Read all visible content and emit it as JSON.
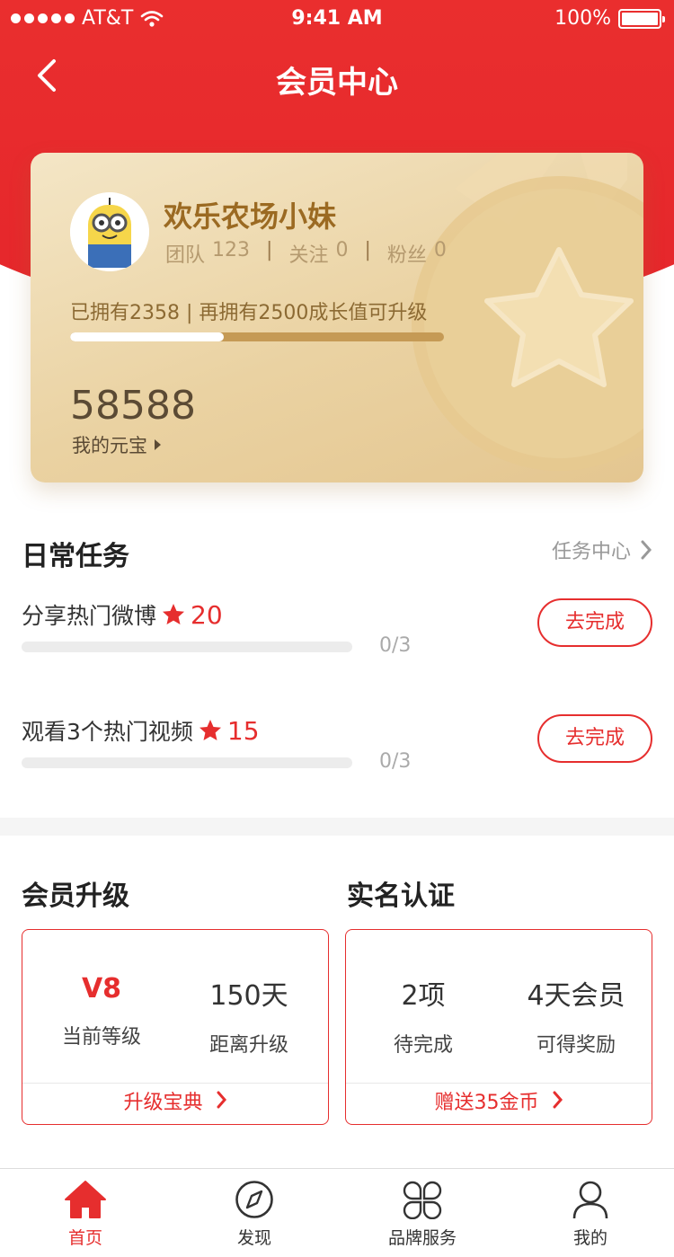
{
  "status_bar": {
    "carrier": "AT&T",
    "time": "9:41 AM",
    "battery": "100%"
  },
  "nav": {
    "title": "会员中心"
  },
  "card": {
    "username": "欢乐农场小妹",
    "stats": [
      {
        "label": "团队",
        "value": "123"
      },
      {
        "label": "关注",
        "value": "0"
      },
      {
        "label": "粉丝",
        "value": "0"
      }
    ],
    "growth_text": "已拥有2358 | 再拥有2500成长值可升级",
    "progress_fraction": 0.41,
    "coins": "58588",
    "coins_label": "我的元宝"
  },
  "daily": {
    "title": "日常任务",
    "center_link": "任务中心",
    "tasks": [
      {
        "name": "分享热门微博",
        "points": "20",
        "count": "0/3",
        "button": "去完成",
        "progress_fraction": 0
      },
      {
        "name": "观看3个热门视频",
        "points": "15",
        "count": "0/3",
        "button": "去完成",
        "progress_fraction": 0
      }
    ]
  },
  "upgrade": {
    "title": "会员升级",
    "left": {
      "value": "V8",
      "label": "当前等级"
    },
    "right": {
      "value": "150天",
      "label": "距离升级"
    },
    "footer": "升级宝典"
  },
  "verify": {
    "title": "实名认证",
    "left": {
      "value": "2项",
      "label": "待完成"
    },
    "right": {
      "value": "4天会员",
      "label": "可得奖励"
    },
    "footer": "赠送35金币"
  },
  "tabbar": [
    {
      "label": "首页",
      "icon": "home-icon",
      "active": true
    },
    {
      "label": "发现",
      "icon": "compass-icon",
      "active": false
    },
    {
      "label": "品牌服务",
      "icon": "clover-icon",
      "active": false
    },
    {
      "label": "我的",
      "icon": "user-icon",
      "active": false
    }
  ],
  "colors": {
    "accent": "#e62e2e",
    "card_gold": "#ead2a2",
    "card_text": "#9b6a22"
  }
}
